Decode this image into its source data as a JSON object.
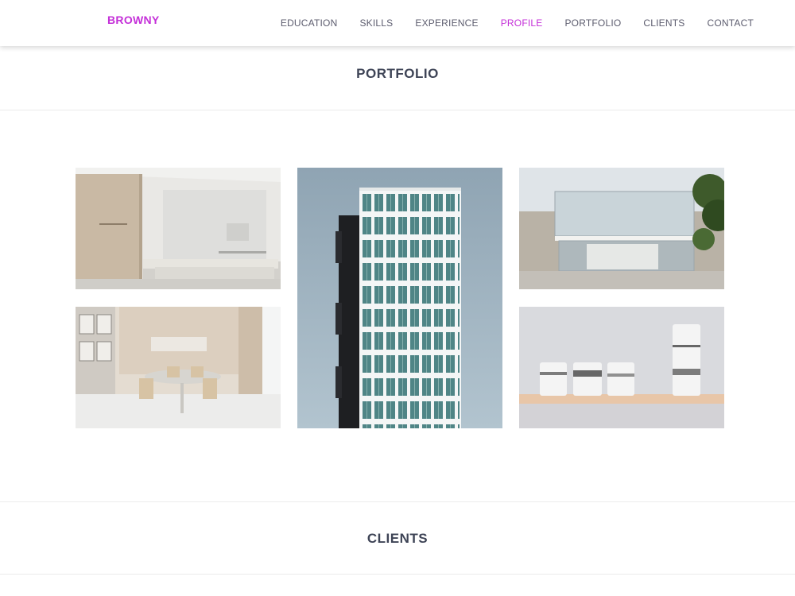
{
  "nav": {
    "brand": "BROWNY",
    "links": [
      "EDUCATION",
      "SKILLS",
      "EXPERIENCE",
      "PROFILE",
      "PORTFOLIO",
      "CLIENTS",
      "CONTACT"
    ],
    "active": "PROFILE",
    "accent_color": "#c42fd8"
  },
  "portfolio": {
    "title": "PORTFOLIO",
    "items": [
      {
        "name": "living-room-photo"
      },
      {
        "name": "glass-tower-photo"
      },
      {
        "name": "glass-pavilion-photo"
      },
      {
        "name": "dining-room-photo"
      },
      {
        "name": "ceramic-vessels-photo"
      }
    ]
  },
  "clients": {
    "title": "CLIENTS"
  }
}
